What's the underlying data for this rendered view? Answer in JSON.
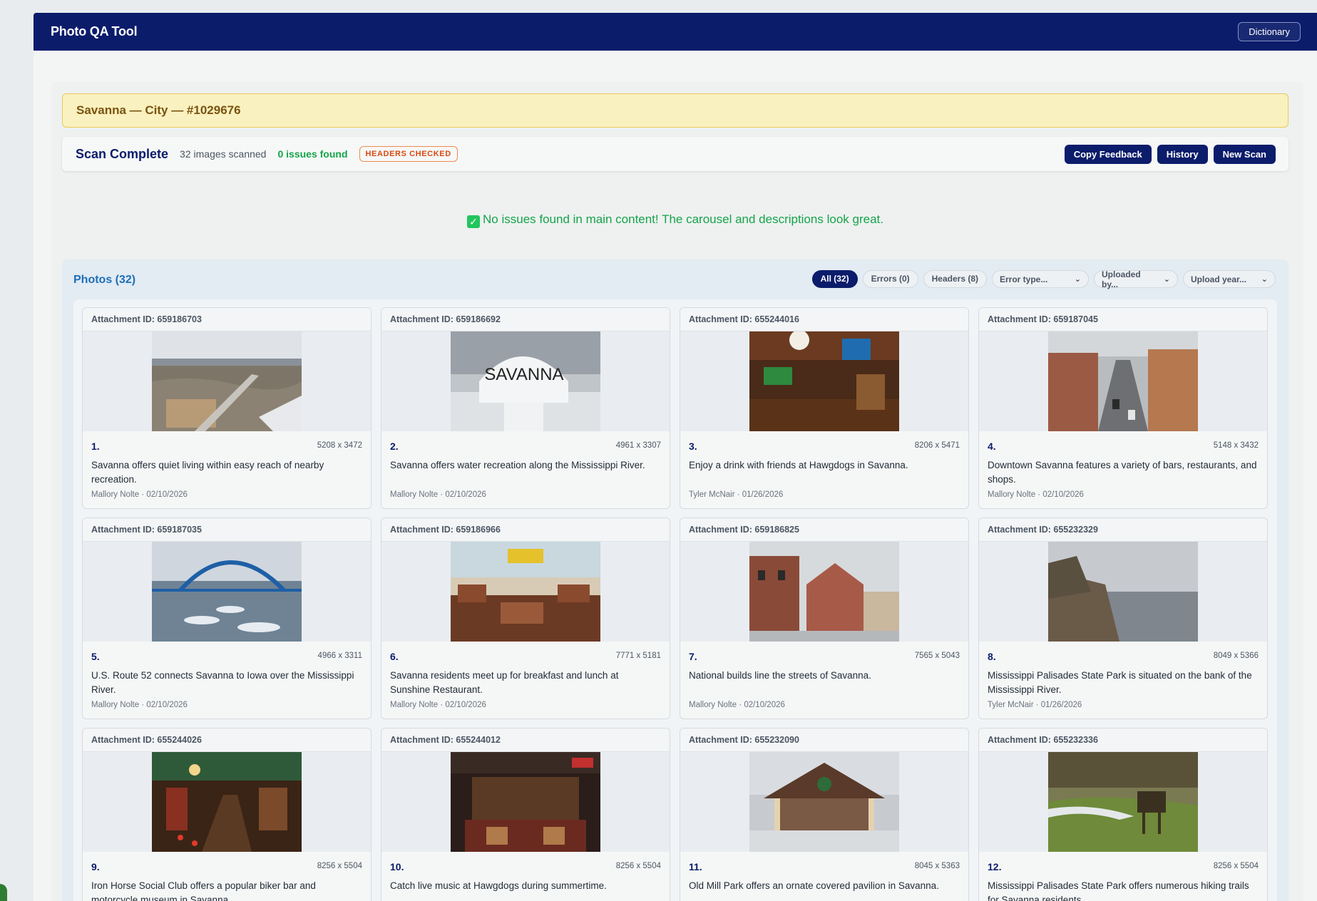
{
  "app": {
    "title": "Photo QA Tool",
    "dictionary_label": "Dictionary"
  },
  "banner": {
    "text": "Savanna — City — #1029676"
  },
  "scan": {
    "title": "Scan Complete",
    "count": "32 images scanned",
    "issues": "0 issues found",
    "badge": "HEADERS CHECKED",
    "actions": {
      "copy": "Copy Feedback",
      "history": "History",
      "new_scan": "New Scan"
    }
  },
  "success": {
    "icon": "check-mark-icon",
    "message": "No issues found in main content! The carousel and descriptions look great."
  },
  "photos": {
    "title": "Photos (32)",
    "filters": {
      "all": "All (32)",
      "errors": "Errors (0)",
      "headers": "Headers (8)"
    },
    "selects": {
      "error_type": "Error type...",
      "uploaded_by": "Uploaded by...",
      "upload_year": "Upload year..."
    },
    "items": [
      {
        "attachment": "Attachment ID: 659186703",
        "num": "1.",
        "dims": "5208 x 3472",
        "desc": "Savanna offers quiet living within easy reach of nearby recreation.",
        "byline": "Mallory Nolte · 02/10/2026",
        "scene": "aerial"
      },
      {
        "attachment": "Attachment ID: 659186692",
        "num": "2.",
        "dims": "4961 x 3307",
        "desc": "Savanna offers water recreation along the Mississippi River.",
        "byline": "Mallory Nolte · 02/10/2026",
        "scene": "tower",
        "tower_text": "SAVANNA"
      },
      {
        "attachment": "Attachment ID: 655244016",
        "num": "3.",
        "dims": "8206 x 5471",
        "desc": "Enjoy a drink with friends at Hawgdogs in Savanna.",
        "byline": "Tyler McNair · 01/26/2026",
        "scene": "bar"
      },
      {
        "attachment": "Attachment ID: 659187045",
        "num": "4.",
        "dims": "5148 x 3432",
        "desc": "Downtown Savanna features a variety of bars, restaurants, and shops.",
        "byline": "Mallory Nolte · 02/10/2026",
        "scene": "street"
      },
      {
        "attachment": "Attachment ID: 659187035",
        "num": "5.",
        "dims": "4966 x 3311",
        "desc": "U.S. Route 52 connects Savanna to Iowa over the Mississippi River.",
        "byline": "Mallory Nolte · 02/10/2026",
        "scene": "bridge"
      },
      {
        "attachment": "Attachment ID: 659186966",
        "num": "6.",
        "dims": "7771 x 5181",
        "desc": "Savanna residents meet up for breakfast and lunch at Sunshine Restaurant.",
        "byline": "Mallory Nolte · 02/10/2026",
        "scene": "diner"
      },
      {
        "attachment": "Attachment ID: 659186825",
        "num": "7.",
        "dims": "7565 x 5043",
        "desc": "National builds line the streets of Savanna.",
        "byline": "Mallory Nolte · 02/10/2026",
        "scene": "houses"
      },
      {
        "attachment": "Attachment ID: 655232329",
        "num": "8.",
        "dims": "8049 x 5366",
        "desc": "Mississippi Palisades State Park is situated on the bank of the Mississippi River.",
        "byline": "Tyler McNair · 01/26/2026",
        "scene": "river"
      },
      {
        "attachment": "Attachment ID: 655244026",
        "num": "9.",
        "dims": "8256 x 5504",
        "desc": "Iron Horse Social Club offers a popular biker bar and motorcycle museum in Savanna.",
        "byline": "",
        "scene": "bar2"
      },
      {
        "attachment": "Attachment ID: 655244012",
        "num": "10.",
        "dims": "8256 x 5504",
        "desc": "Catch live music at Hawgdogs during summertime.",
        "byline": "",
        "scene": "stage"
      },
      {
        "attachment": "Attachment ID: 655232090",
        "num": "11.",
        "dims": "8045 x 5363",
        "desc": "Old Mill Park offers an ornate covered pavilion in Savanna.",
        "byline": "",
        "scene": "pavilion"
      },
      {
        "attachment": "Attachment ID: 655232336",
        "num": "12.",
        "dims": "8256 x 5504",
        "desc": "Mississippi Palisades State Park offers numerous hiking trails for Savanna residents.",
        "byline": "",
        "scene": "trail"
      }
    ]
  }
}
